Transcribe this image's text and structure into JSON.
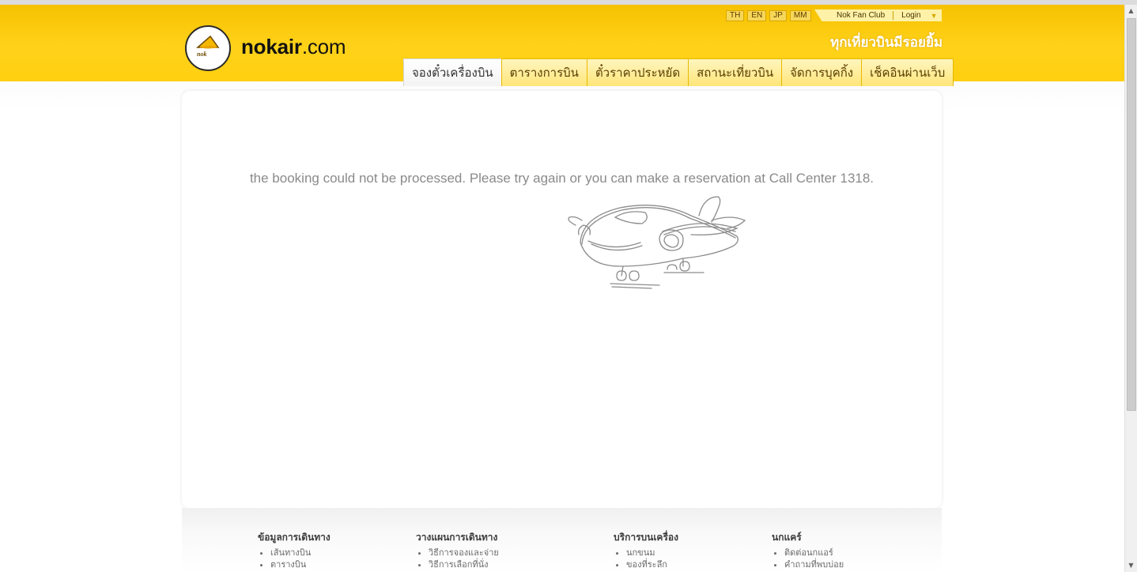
{
  "header": {
    "logo_bold": "nokair",
    "logo_suffix": ".com",
    "logo_badge": "nok",
    "languages": [
      "TH",
      "EN",
      "JP",
      "MM"
    ],
    "fan_club": "Nok Fan Club",
    "login": "Login",
    "slogan": "ทุกเที่ยวบินมีรอยยิ้ม"
  },
  "nav": {
    "tabs": [
      {
        "label": "จองตั๋วเครื่องบิน",
        "active": true
      },
      {
        "label": "ตารางการบิน"
      },
      {
        "label": "ตั๋วราคาประหยัด"
      },
      {
        "label": "สถานะเที่ยวบิน"
      },
      {
        "label": "จัดการบุคกิ้ง"
      },
      {
        "label": "เช็คอินผ่านเว็บ"
      }
    ]
  },
  "main": {
    "error_message": "the booking could not be processed. Please try again or you can make a reservation at Call Center 1318."
  },
  "footer": {
    "columns": [
      {
        "title": "ข้อมูลการเดินทาง",
        "items": [
          "เส้นทางบิน",
          "ตารางบิน"
        ]
      },
      {
        "title": "วางแผนการเดินทาง",
        "items": [
          "วิธีการจองและจ่าย",
          "วิธีการเลือกที่นั่ง"
        ]
      },
      {
        "title": "บริการบนเครื่อง",
        "items": [
          "นกขนม",
          "ของที่ระลึก"
        ]
      },
      {
        "title": "นกแคร์",
        "items": [
          "ติดต่อนกแอร์",
          "คำถามที่พบบ่อย"
        ]
      }
    ]
  },
  "colors": {
    "brand_yellow": "#FFD21A",
    "message_gray": "#8A8A8A"
  }
}
